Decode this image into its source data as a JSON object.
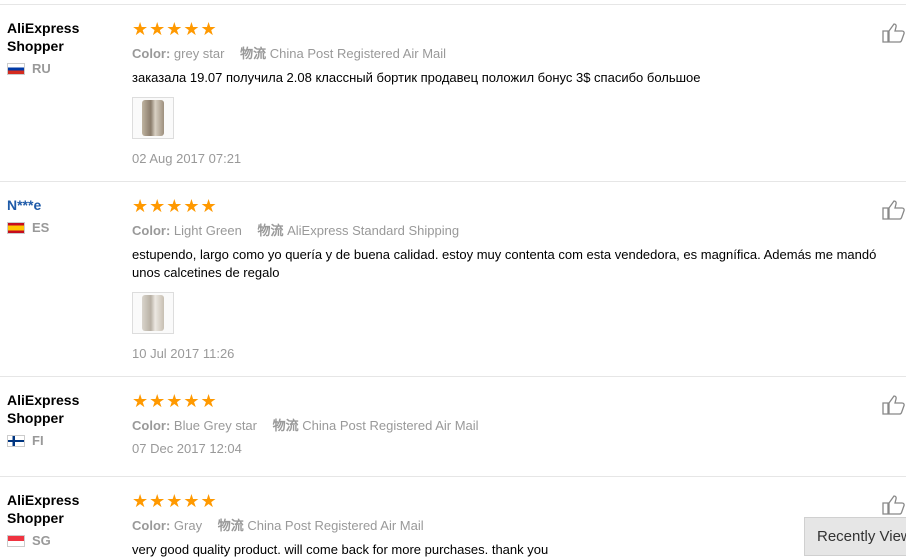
{
  "reviews": [
    {
      "user": "AliExpress Shopper",
      "country": "RU",
      "stars": "★★★★★",
      "color_label": "Color:",
      "color_value": "grey star",
      "shipping_label": "物流",
      "shipping_value": "China Post Registered Air Mail",
      "text": "заказала 19.07 получила 2.08 классный бортик продавец положил бонус 3$ спасибо большое",
      "date": "02 Aug 2017 07:21"
    },
    {
      "user": "N***e",
      "country": "ES",
      "stars": "★★★★★",
      "color_label": "Color:",
      "color_value": "Light Green",
      "shipping_label": "物流",
      "shipping_value": "AliExpress Standard Shipping",
      "text": "estupendo, largo como yo quería y de buena calidad. estoy muy contenta com esta vendedora, es magnífica. Además me mandó unos calcetines de regalo",
      "date": "10 Jul 2017 11:26"
    },
    {
      "user": "AliExpress Shopper",
      "country": "FI",
      "stars": "★★★★★",
      "color_label": "Color:",
      "color_value": "Blue Grey star",
      "shipping_label": "物流",
      "shipping_value": "China Post Registered Air Mail",
      "date": "07 Dec 2017 12:04"
    },
    {
      "user": "AliExpress Shopper",
      "country": "SG",
      "stars": "★★★★★",
      "color_label": "Color:",
      "color_value": "Gray",
      "shipping_label": "物流",
      "shipping_value": "China Post Registered Air Mail",
      "text": "very good quality product. will come back for more purchases. thank you"
    }
  ],
  "recently_viewed": "Recently Viewed",
  "colors": {
    "star": "#ff9900",
    "link": "#1e5aa8",
    "muted": "#999999"
  }
}
